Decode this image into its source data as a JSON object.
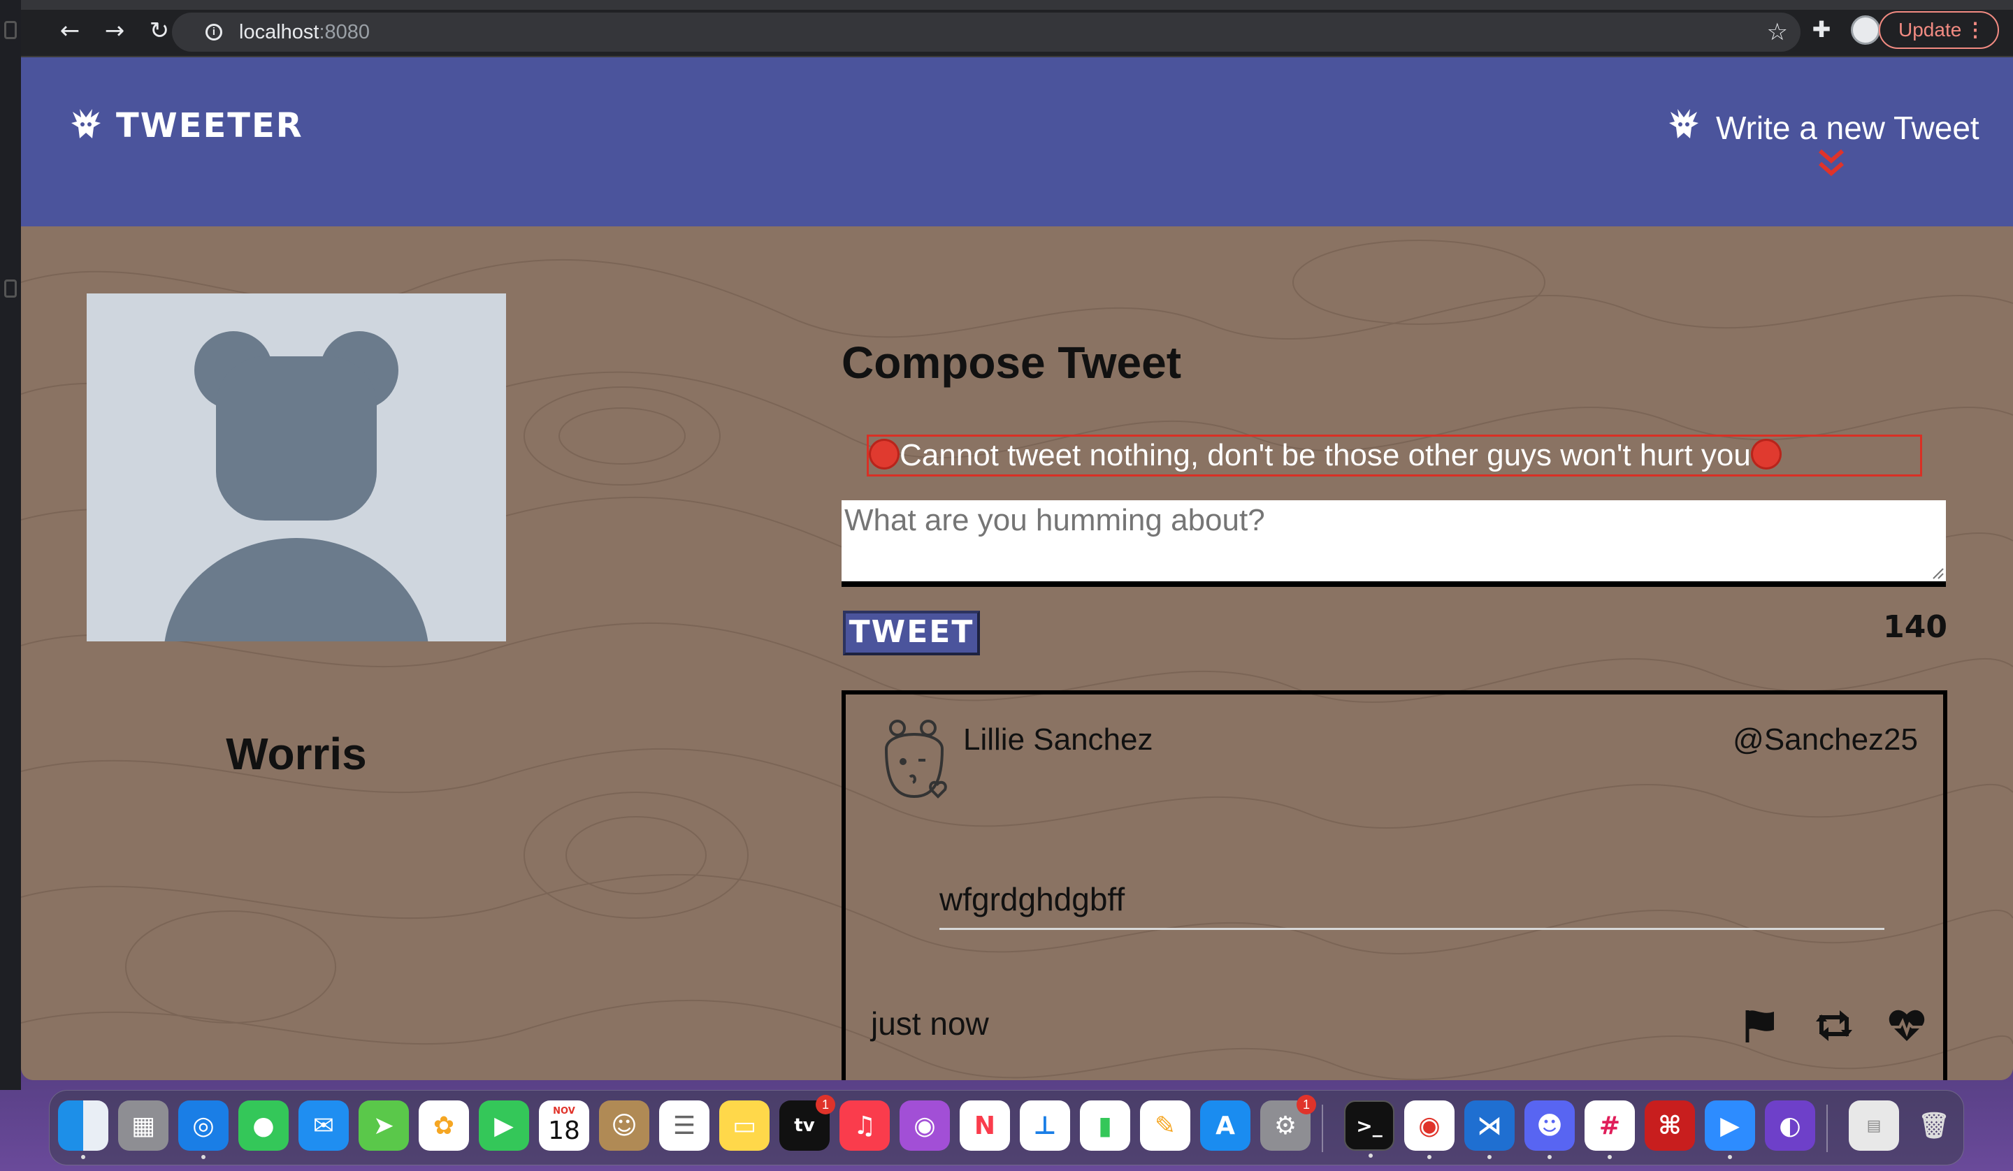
{
  "browser": {
    "url_host": "localhost",
    "url_port": ":8080",
    "update_label": "Update"
  },
  "header": {
    "brand": "TWEETER",
    "write_link": "Write a new Tweet"
  },
  "profile": {
    "name": "Worris"
  },
  "compose": {
    "title": "Compose Tweet",
    "error": "Cannot tweet nothing, don't be those other guys won't hurt you",
    "placeholder": "What are you humming about?",
    "button_label": "TWEET",
    "char_count": "140"
  },
  "tweets": [
    {
      "author": "Lillie Sanchez",
      "handle": "@Sanchez25",
      "body": "wfgrdghdgbff",
      "time": "just now"
    }
  ],
  "dock": {
    "calendar_month": "NOV",
    "calendar_day": "18",
    "tv_label": "tv",
    "tv_badge": "1",
    "settings_badge": "1"
  },
  "colors": {
    "header_bg": "#4b549c",
    "content_bg": "#8a7363",
    "error_border": "#d93025"
  }
}
